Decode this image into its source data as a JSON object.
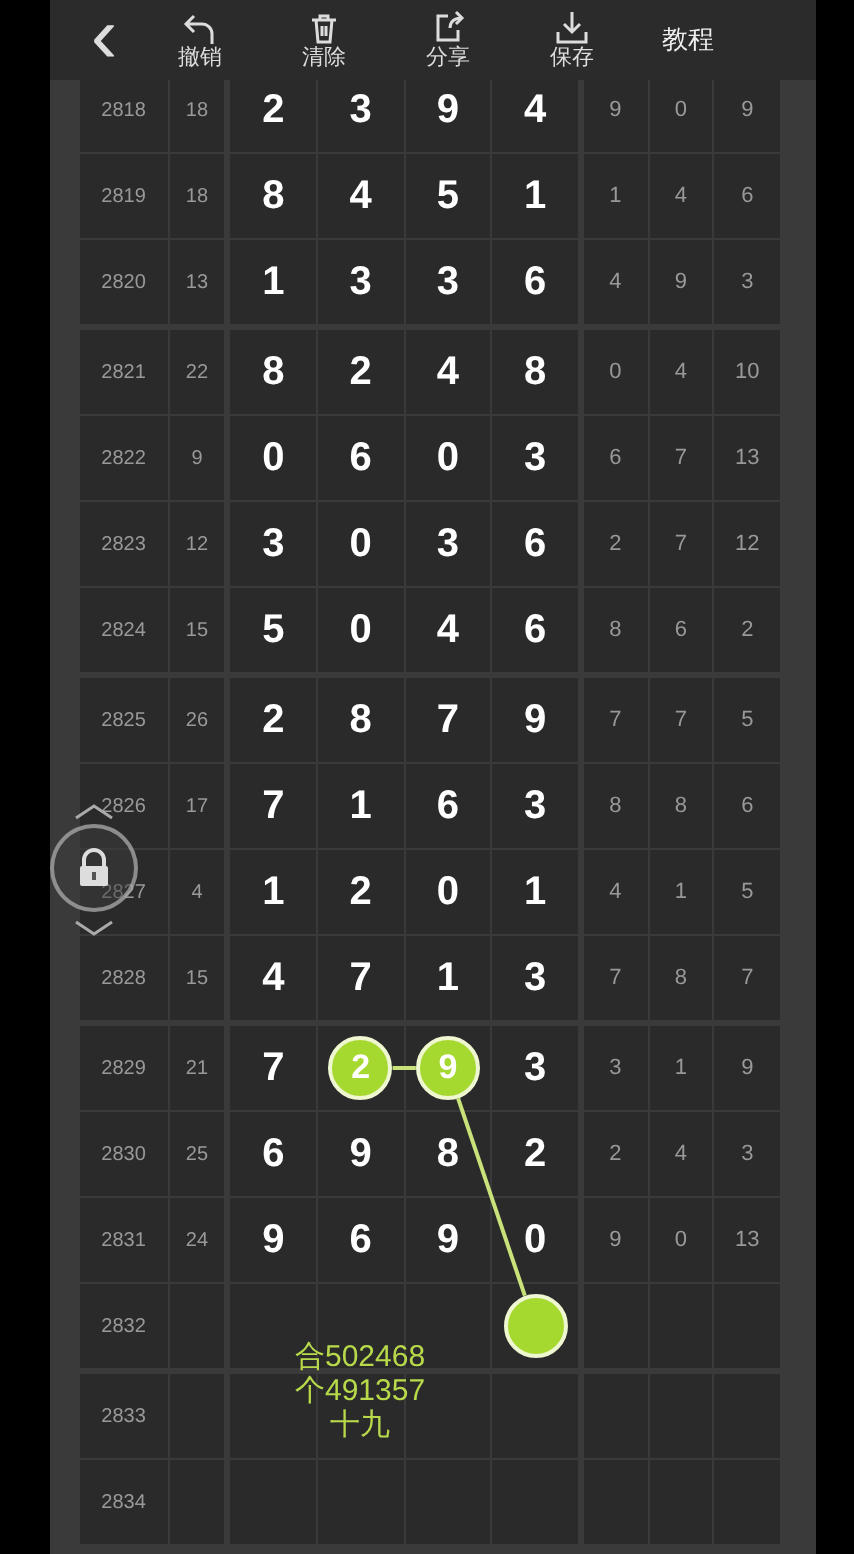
{
  "toolbar": {
    "back": "‹",
    "actions": [
      {
        "kind": "undo",
        "label": "撤销"
      },
      {
        "kind": "clear",
        "label": "清除"
      },
      {
        "kind": "share",
        "label": "分享"
      },
      {
        "kind": "save",
        "label": "保存"
      }
    ],
    "tutorial": "教程"
  },
  "groups": [
    {
      "rows": [
        {
          "issue": "2818",
          "sum": "18",
          "cells": [
            {
              "value": "2",
              "circled": false
            },
            {
              "value": "3",
              "circled": false
            },
            {
              "value": "9",
              "circled": false
            },
            {
              "value": "4",
              "circled": false
            }
          ],
          "extra": [
            "9",
            "0",
            "9"
          ]
        },
        {
          "issue": "2819",
          "sum": "18",
          "cells": [
            {
              "value": "8",
              "circled": false
            },
            {
              "value": "4",
              "circled": false
            },
            {
              "value": "5",
              "circled": false
            },
            {
              "value": "1",
              "circled": false
            }
          ],
          "extra": [
            "1",
            "4",
            "6"
          ]
        },
        {
          "issue": "2820",
          "sum": "13",
          "cells": [
            {
              "value": "1",
              "circled": false
            },
            {
              "value": "3",
              "circled": false
            },
            {
              "value": "3",
              "circled": false
            },
            {
              "value": "6",
              "circled": false
            }
          ],
          "extra": [
            "4",
            "9",
            "3"
          ]
        }
      ]
    },
    {
      "rows": [
        {
          "issue": "2821",
          "sum": "22",
          "cells": [
            {
              "value": "8",
              "circled": false
            },
            {
              "value": "2",
              "circled": false
            },
            {
              "value": "4",
              "circled": false
            },
            {
              "value": "8",
              "circled": false
            }
          ],
          "extra": [
            "0",
            "4",
            "10"
          ]
        },
        {
          "issue": "2822",
          "sum": "9",
          "cells": [
            {
              "value": "0",
              "circled": false
            },
            {
              "value": "6",
              "circled": false
            },
            {
              "value": "0",
              "circled": false
            },
            {
              "value": "3",
              "circled": false
            }
          ],
          "extra": [
            "6",
            "7",
            "13"
          ]
        },
        {
          "issue": "2823",
          "sum": "12",
          "cells": [
            {
              "value": "3",
              "circled": false
            },
            {
              "value": "0",
              "circled": false
            },
            {
              "value": "3",
              "circled": false
            },
            {
              "value": "6",
              "circled": false
            }
          ],
          "extra": [
            "2",
            "7",
            "12"
          ]
        },
        {
          "issue": "2824",
          "sum": "15",
          "cells": [
            {
              "value": "5",
              "circled": false
            },
            {
              "value": "0",
              "circled": false
            },
            {
              "value": "4",
              "circled": false
            },
            {
              "value": "6",
              "circled": false
            }
          ],
          "extra": [
            "8",
            "6",
            "2"
          ]
        }
      ]
    },
    {
      "rows": [
        {
          "issue": "2825",
          "sum": "26",
          "cells": [
            {
              "value": "2",
              "circled": false
            },
            {
              "value": "8",
              "circled": false
            },
            {
              "value": "7",
              "circled": false
            },
            {
              "value": "9",
              "circled": false
            }
          ],
          "extra": [
            "7",
            "7",
            "5"
          ]
        },
        {
          "issue": "2826",
          "sum": "17",
          "cells": [
            {
              "value": "7",
              "circled": false
            },
            {
              "value": "1",
              "circled": false
            },
            {
              "value": "6",
              "circled": false
            },
            {
              "value": "3",
              "circled": false
            }
          ],
          "extra": [
            "8",
            "8",
            "6"
          ]
        },
        {
          "issue": "2827",
          "sum": "4",
          "cells": [
            {
              "value": "1",
              "circled": false
            },
            {
              "value": "2",
              "circled": false
            },
            {
              "value": "0",
              "circled": false
            },
            {
              "value": "1",
              "circled": false
            }
          ],
          "extra": [
            "4",
            "1",
            "5"
          ]
        },
        {
          "issue": "2828",
          "sum": "15",
          "cells": [
            {
              "value": "4",
              "circled": false
            },
            {
              "value": "7",
              "circled": false
            },
            {
              "value": "1",
              "circled": false
            },
            {
              "value": "3",
              "circled": false
            }
          ],
          "extra": [
            "7",
            "8",
            "7"
          ]
        }
      ]
    },
    {
      "rows": [
        {
          "issue": "2829",
          "sum": "21",
          "cells": [
            {
              "value": "7",
              "circled": false
            },
            {
              "value": "2",
              "circled": true
            },
            {
              "value": "9",
              "circled": true
            },
            {
              "value": "3",
              "circled": false
            }
          ],
          "extra": [
            "3",
            "1",
            "9"
          ]
        },
        {
          "issue": "2830",
          "sum": "25",
          "cells": [
            {
              "value": "6",
              "circled": false
            },
            {
              "value": "9",
              "circled": false
            },
            {
              "value": "8",
              "circled": false
            },
            {
              "value": "2",
              "circled": false
            }
          ],
          "extra": [
            "2",
            "4",
            "3"
          ]
        },
        {
          "issue": "2831",
          "sum": "24",
          "cells": [
            {
              "value": "9",
              "circled": false
            },
            {
              "value": "6",
              "circled": false
            },
            {
              "value": "9",
              "circled": false
            },
            {
              "value": "0",
              "circled": false
            }
          ],
          "extra": [
            "9",
            "0",
            "13"
          ]
        },
        {
          "issue": "2832",
          "cells": [
            {
              "circled": false
            },
            {
              "circled": false
            },
            {
              "circled": false
            },
            {
              "circled": true
            }
          ]
        }
      ]
    },
    {
      "rows": [
        {
          "issue": "2833",
          "cells": [
            {
              "circled": false
            },
            {
              "circled": false
            },
            {
              "circled": false
            },
            {
              "circled": false
            }
          ]
        },
        {
          "issue": "2834",
          "cells": [
            {
              "circled": false
            },
            {
              "circled": false
            },
            {
              "circled": false
            },
            {
              "circled": false
            }
          ]
        }
      ]
    }
  ],
  "note": [
    "合502468",
    "个491357",
    "十九"
  ],
  "lock": {
    "locked": true
  }
}
